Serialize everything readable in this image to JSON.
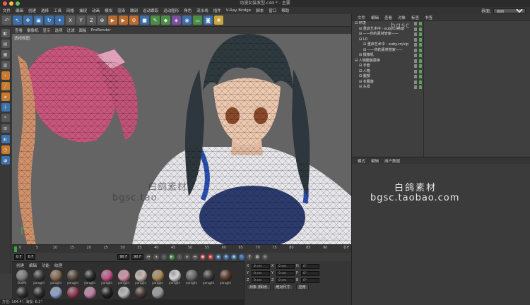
{
  "window": {
    "title": "动漫女装发型.c4d * - 主要"
  },
  "menubar": [
    "文件",
    "编辑",
    "创建",
    "选择",
    "工具",
    "网格",
    "捕捉",
    "动画",
    "模拟",
    "渲染",
    "雕刻",
    "运动跟踪",
    "运动图形",
    "角色",
    "流水线",
    "插件",
    "V-Ray Bridge",
    "脚本",
    "窗口",
    "帮助"
  ],
  "interface": {
    "label": "界面:",
    "value": "启动"
  },
  "viewport": {
    "menu": [
      "查看",
      "摄像机",
      "显示",
      "选项",
      "过滤",
      "面板",
      "ProRender"
    ],
    "label": "透视视图",
    "grid": "网格间距 : 10000 cm"
  },
  "watermark": {
    "cn": "白鸽素材",
    "url": "bgsc.taobao.com",
    "url_partial": "bgsc.tao",
    "top": "bgsc"
  },
  "timeline": {
    "ticks": [
      "0",
      "5",
      "10",
      "15",
      "20",
      "25",
      "30",
      "35",
      "40",
      "45",
      "50",
      "55",
      "60",
      "65",
      "70",
      "75",
      "80",
      "85",
      "90"
    ],
    "frame_end": "0 F"
  },
  "timectl": {
    "start": "0 F",
    "cur": "0 F",
    "end": "90 F",
    "end2": "90 F"
  },
  "materials": {
    "menu": [
      "创建",
      "编辑",
      "功能",
      "纹理"
    ],
    "items": [
      {
        "label": "Outfit",
        "color": "#7c7c7c"
      },
      {
        "label": "yangjin",
        "color": "#3b3b3b"
      },
      {
        "label": "yangjin",
        "color": "#8a6a4f"
      },
      {
        "label": "yangjin",
        "color": "#5a4a3e"
      },
      {
        "label": "yangjin",
        "color": "#2a2a2a"
      },
      {
        "label": "yangjin",
        "color": "#c6508a"
      },
      {
        "label": "yangjin",
        "color": "#d98fa8"
      },
      {
        "label": "yangjin",
        "color": "#c9b8b0"
      },
      {
        "label": "yangjin",
        "color": "#b08a5a"
      },
      {
        "label": "yangjin",
        "color": "#d4d4d4"
      },
      {
        "label": "yangjin",
        "color": "#6a6a6a"
      },
      {
        "label": "yangjin",
        "color": "#3a3a3a"
      },
      {
        "label": "yangjin",
        "color": "#5e3a2a"
      },
      {
        "label": "yangjin",
        "color": "#303030"
      },
      {
        "label": "",
        "color": "#2c2c2c"
      },
      {
        "label": "",
        "color": "#8aa0c8"
      },
      {
        "label": "",
        "color": "#9a3a55"
      },
      {
        "label": "",
        "color": "#c47fa5"
      },
      {
        "label": "",
        "color": "#232323"
      },
      {
        "label": "",
        "color": "#b9b9b9"
      },
      {
        "label": "",
        "color": "#4a3a36"
      },
      {
        "label": "",
        "color": "#9a9a9a"
      }
    ]
  },
  "coords": {
    "rows": [
      {
        "axis": "X",
        "a": "0 cm",
        "b": "0 cm",
        "h": "H",
        "hv": "0°"
      },
      {
        "axis": "Y",
        "a": "0 cm",
        "b": "0 cm",
        "h": "P",
        "hv": "0°"
      },
      {
        "axis": "Z",
        "a": "0 cm",
        "b": "0 cm",
        "h": "B",
        "hv": "0°"
      }
    ],
    "mode": "对象 (相对)",
    "size": "绝对尺寸",
    "apply": "应用"
  },
  "status": "方位: 164.4°, 海拔: 6.2°",
  "objects": {
    "menu": [
      "文件",
      "编辑",
      "查看",
      "对象",
      "标签",
      "书签"
    ],
    "rows": [
      {
        "indent": 0,
        "name": "环境"
      },
      {
        "indent": 1,
        "name": "重启艺术中 - euby.cn/vip"
      },
      {
        "indent": 1,
        "name": "——你的素材管家——"
      },
      {
        "indent": 1,
        "name": "L0"
      },
      {
        "indent": 2,
        "name": "重启艺术中 - euby.cn/vip"
      },
      {
        "indent": 2,
        "name": "——你的素材管家——"
      },
      {
        "indent": 1,
        "name": "摄像机"
      },
      {
        "indent": 0,
        "name": "人物服装更换"
      },
      {
        "indent": 1,
        "name": "手套"
      },
      {
        "indent": 1,
        "name": "人物"
      },
      {
        "indent": 1,
        "name": "腿部"
      },
      {
        "indent": 1,
        "name": "衣服装"
      },
      {
        "indent": 1,
        "name": "头发"
      }
    ]
  },
  "attr_menu": [
    "模式",
    "编辑",
    "用户数据"
  ]
}
